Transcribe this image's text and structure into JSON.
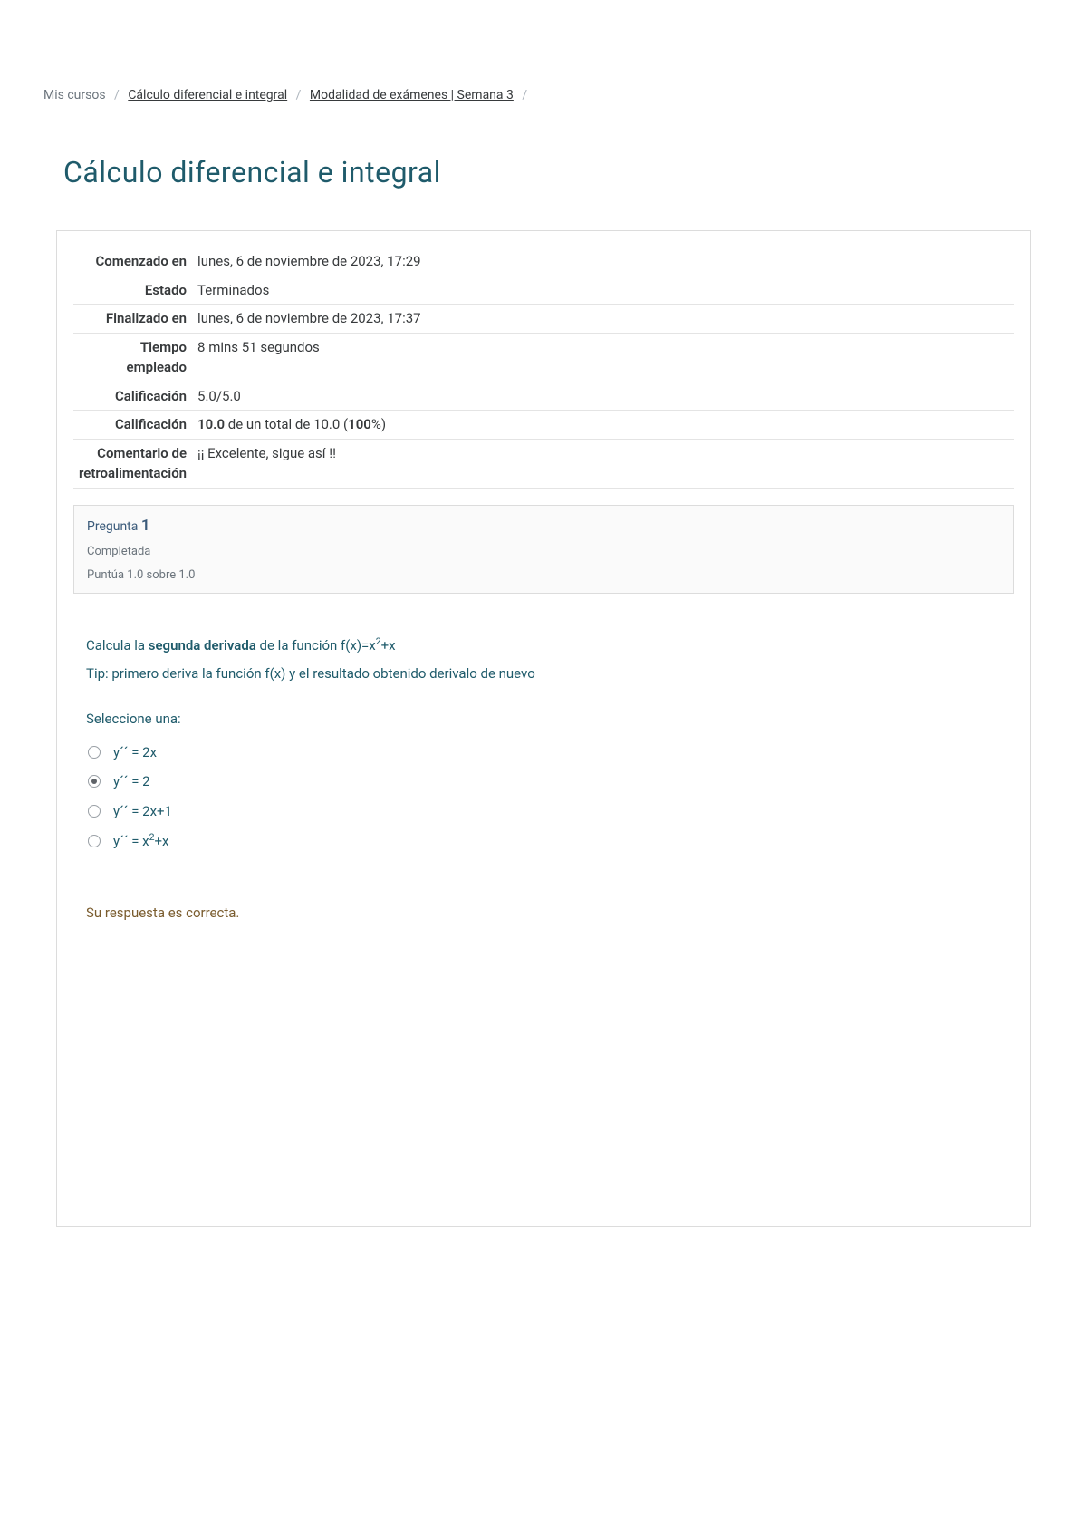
{
  "breadcrumb": {
    "items": [
      {
        "text": "Mis cursos",
        "link": false
      },
      {
        "text": "Cálculo diferencial e integral",
        "link": true
      },
      {
        "text": "Modalidad de exámenes | Semana 3",
        "link": true
      }
    ]
  },
  "page_title": "Cálculo diferencial e integral",
  "summary": {
    "rows": [
      {
        "label": "Comenzado en",
        "value": "lunes, 6 de noviembre de 2023, 17:29"
      },
      {
        "label": "Estado",
        "value": "Terminados"
      },
      {
        "label": "Finalizado en",
        "value": "lunes, 6 de noviembre de 2023, 17:37"
      },
      {
        "label": "Tiempo empleado",
        "value": "8 mins 51 segundos"
      },
      {
        "label": "Calificación",
        "value": "5.0/5.0"
      }
    ],
    "grade_row": {
      "label": "Calificación",
      "bold_value": "10.0",
      "mid": " de un total de 10.0 (",
      "bold_pct": "100",
      "tail": "%)"
    },
    "feedback_row": {
      "label": "Comentario de retroalimentación",
      "value": "¡¡ Excelente, sigue así !!"
    }
  },
  "question": {
    "label_prefix": "Pregunta ",
    "number": "1",
    "state": "Completada",
    "score_text": "Puntúa 1.0 sobre 1.0",
    "prompt_pre": "Calcula la ",
    "prompt_bold": "segunda derivada",
    "prompt_post": " de la función f(x)=x",
    "prompt_sup": "2",
    "prompt_tail": "+x",
    "tip": "Tip: primero deriva la función f(x) y el resultado obtenido derivalo de nuevo",
    "select_one": "Seleccione una:",
    "options": [
      {
        "text": "y´´ = 2x",
        "has_sup": false,
        "selected": false
      },
      {
        "text": "y´´ = 2",
        "has_sup": false,
        "selected": true
      },
      {
        "text": "y´´ = 2x+1",
        "has_sup": false,
        "selected": false
      },
      {
        "text_pre": "y´´ = x",
        "sup": "2",
        "text_post": "+x",
        "has_sup": true,
        "selected": false
      }
    ],
    "feedback": "Su respuesta es correcta."
  }
}
